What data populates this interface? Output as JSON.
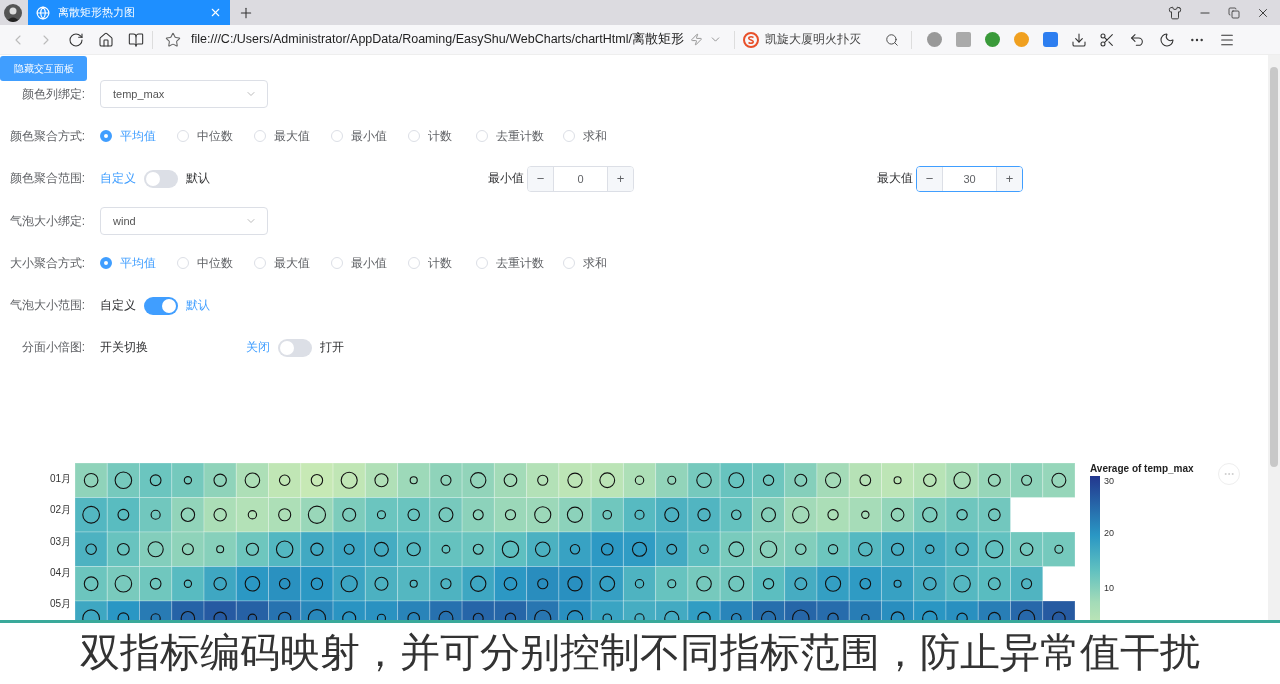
{
  "browser": {
    "tab": {
      "title": "离散矩形热力图",
      "selected": true
    },
    "address": "file:///C:/Users/Administrator/AppData/Roaming/EasyShu/WebCharts/chartHtml/离散矩形",
    "search_value": "凯旋大厦明火扑灭"
  },
  "panel_button": "隐藏交互面板",
  "form": [
    {
      "kind": "select",
      "label": "颜色列绑定:",
      "value": "temp_max"
    },
    {
      "kind": "radio",
      "label": "颜色聚合方式:",
      "options": [
        {
          "label": "平均值",
          "selected": true
        },
        {
          "label": "中位数",
          "selected": false
        },
        {
          "label": "最大值",
          "selected": false
        },
        {
          "label": "最小值",
          "selected": false
        },
        {
          "label": "计数",
          "selected": false
        },
        {
          "label": "去重计数",
          "selected": false
        },
        {
          "label": "求和",
          "selected": false
        }
      ]
    },
    {
      "kind": "range",
      "label": "颜色聚合范围:",
      "left": "自定义",
      "right": "默认",
      "on": false,
      "min": {
        "label": "最小值",
        "minus": "−",
        "value": "0",
        "plus": "+",
        "focused": false
      },
      "max": {
        "label": "最大值",
        "minus": "−",
        "value": "30",
        "plus": "+",
        "focused": true
      }
    },
    {
      "kind": "select",
      "label": "气泡大小绑定:",
      "value": "wind"
    },
    {
      "kind": "radio",
      "label": "大小聚合方式:",
      "options": [
        {
          "label": "平均值",
          "selected": true
        },
        {
          "label": "中位数",
          "selected": false
        },
        {
          "label": "最大值",
          "selected": false
        },
        {
          "label": "最小值",
          "selected": false
        },
        {
          "label": "计数",
          "selected": false
        },
        {
          "label": "去重计数",
          "selected": false
        },
        {
          "label": "求和",
          "selected": false
        }
      ]
    },
    {
      "kind": "switch",
      "label": "气泡大小范围:",
      "left": "自定义",
      "right": "默认",
      "on": true
    },
    {
      "kind": "facet",
      "label": "分面小倍图:",
      "text": "开关切换",
      "left": "关闭",
      "right": "打开",
      "on": false
    }
  ],
  "chart": {
    "rows": [
      "01月",
      "02月",
      "03月",
      "04月",
      "05月"
    ],
    "legend": {
      "title": "Average of temp_max",
      "ticks": [
        "30",
        "20",
        "10"
      ]
    }
  },
  "caption": "双指标编码映射，并可分别控制不同指标范围，防止异常值干扰"
}
